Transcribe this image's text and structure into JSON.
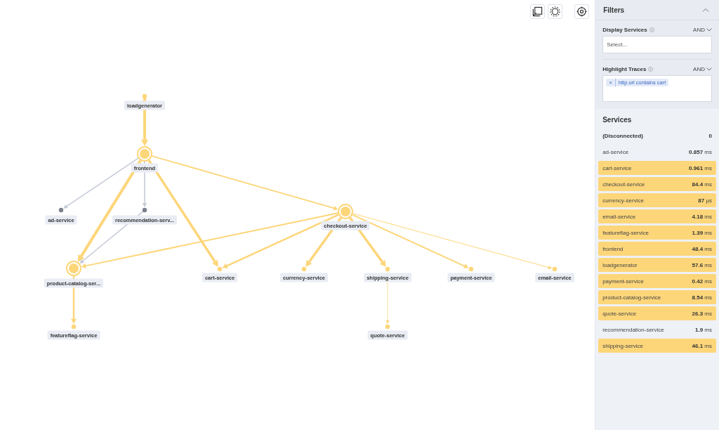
{
  "graph": {
    "nodes": [
      {
        "label": "loadgenerator",
        "kind": "dot",
        "highlighted": true
      },
      {
        "label": "frontend",
        "kind": "ring",
        "highlighted": true
      },
      {
        "label": "ad-service",
        "kind": "dot",
        "highlighted": false
      },
      {
        "label": "recommendation-serv...",
        "kind": "dot",
        "highlighted": false
      },
      {
        "label": "product-catalog-ser...",
        "kind": "ring",
        "highlighted": true
      },
      {
        "label": "cart-service",
        "kind": "dot",
        "highlighted": true
      },
      {
        "label": "checkout-service",
        "kind": "ring",
        "highlighted": true
      },
      {
        "label": "currency-service",
        "kind": "dot",
        "highlighted": true
      },
      {
        "label": "shipping-service",
        "kind": "dot",
        "highlighted": true
      },
      {
        "label": "payment-service",
        "kind": "dot",
        "highlighted": true
      },
      {
        "label": "email-service",
        "kind": "dot",
        "highlighted": true
      },
      {
        "label": "featureflag-service",
        "kind": "dot",
        "highlighted": true
      },
      {
        "label": "quote-service",
        "kind": "dot",
        "highlighted": true
      }
    ],
    "edges": [
      {
        "highlighted": true
      },
      {
        "highlighted": false
      },
      {
        "highlighted": false
      },
      {
        "highlighted": true
      },
      {
        "highlighted": true
      },
      {
        "highlighted": true
      },
      {
        "highlighted": false
      },
      {
        "highlighted": true
      },
      {
        "highlighted": true
      },
      {
        "highlighted": true
      },
      {
        "highlighted": true
      },
      {
        "highlighted": true
      },
      {
        "highlighted": true
      },
      {
        "highlighted": true
      },
      {
        "highlighted": true
      }
    ]
  },
  "filters": {
    "title": "Filters",
    "expanded": true,
    "display_services": {
      "label": "Display Services",
      "operator": "AND",
      "placeholder": "Select..."
    },
    "highlight_traces": {
      "label": "Highlight Traces",
      "operator": "AND",
      "tags": [
        {
          "remove": "×",
          "text": "http.url contains cart"
        }
      ]
    }
  },
  "services": {
    "title": "Services",
    "rows": [
      {
        "name": "(Disconnected)",
        "value": "0",
        "highlighted": false,
        "kind": "header"
      },
      {
        "name": "ad-service",
        "value": "0.857",
        "unit": "ms",
        "highlighted": false,
        "kind": "service"
      },
      {
        "name": "cart-service",
        "value": "0.961",
        "unit": "ms",
        "highlighted": true,
        "kind": "service"
      },
      {
        "name": "checkout-service",
        "value": "84.4",
        "unit": "ms",
        "highlighted": true,
        "kind": "service"
      },
      {
        "name": "currency-service",
        "value": "87",
        "unit": "µs",
        "highlighted": true,
        "kind": "service"
      },
      {
        "name": "email-service",
        "value": "4.18",
        "unit": "ms",
        "highlighted": true,
        "kind": "service"
      },
      {
        "name": "featureflag-service",
        "value": "1.39",
        "unit": "ms",
        "highlighted": true,
        "kind": "service"
      },
      {
        "name": "frontend",
        "value": "48.4",
        "unit": "ms",
        "highlighted": true,
        "kind": "service"
      },
      {
        "name": "loadgenerator",
        "value": "57.6",
        "unit": "ms",
        "highlighted": true,
        "kind": "service"
      },
      {
        "name": "payment-service",
        "value": "0.42",
        "unit": "ms",
        "highlighted": true,
        "kind": "service"
      },
      {
        "name": "product-catalog-service",
        "value": "8.54",
        "unit": "ms",
        "highlighted": true,
        "kind": "service"
      },
      {
        "name": "quote-service",
        "value": "26.3",
        "unit": "ms",
        "highlighted": true,
        "kind": "service"
      },
      {
        "name": "recommendation-service",
        "value": "1.9",
        "unit": "ms",
        "highlighted": false,
        "kind": "service"
      },
      {
        "name": "shipping-service",
        "value": "46.1",
        "unit": "ms",
        "highlighted": true,
        "kind": "service"
      }
    ]
  }
}
